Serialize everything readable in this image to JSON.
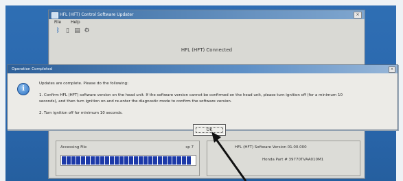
{
  "app": {
    "title": "HFL (HFT) Control Software Updater",
    "close": "×",
    "menu": [
      "File",
      "Help"
    ],
    "toolbar_icons": [
      "bluetooth-icon",
      "document-icon",
      "printer-icon",
      "gear-icon"
    ],
    "connection_status": "HFL (HFT) Connected"
  },
  "progress": {
    "label": "Accessing File",
    "value_text": "sp 7",
    "fraction": 0.98,
    "segments": 28
  },
  "info_panel": {
    "line1": "HFL (HFT) Software Version   01.00.000",
    "line2": "Honda Part #   39770TVAA010M1"
  },
  "dialog": {
    "title": "Operation Completed",
    "close": "×",
    "line1": "Updates are complete.  Please do the following:",
    "line2": "1.  Confirm HFL (HFT) software version on the head unit.  If the software version cannot be confirmed on the head unit, please turn ignition off (for a minimum 10",
    "line3": "seconds), and then turn ignition on and re-enter the diagnostic mode to confirm the software version.",
    "line4": "2.  Turn ignition off for minimum 10 seconds.",
    "ok_label": "OK"
  }
}
